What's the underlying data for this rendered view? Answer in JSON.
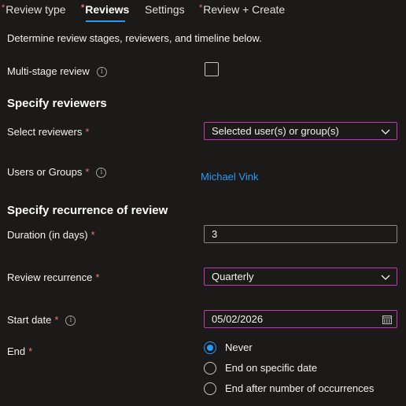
{
  "tabs": [
    {
      "label": "Review type",
      "required": true
    },
    {
      "label": "Reviews",
      "required": true,
      "active": true
    },
    {
      "label": "Settings",
      "required": false
    },
    {
      "label": "Review + Create",
      "required": true
    }
  ],
  "description": "Determine review stages, reviewers, and timeline below.",
  "multistage": {
    "label": "Multi-stage review",
    "checked": false
  },
  "reviewers_section": {
    "title": "Specify reviewers",
    "select_label": "Select reviewers",
    "select_value": "Selected user(s) or group(s)",
    "users_label": "Users or Groups",
    "users_value": "Michael Vink"
  },
  "recurrence_section": {
    "title": "Specify recurrence of review",
    "duration_label": "Duration (in days)",
    "duration_value": "3",
    "recurrence_label": "Review recurrence",
    "recurrence_value": "Quarterly",
    "start_label": "Start date",
    "start_value": "05/02/2026",
    "end_label": "End",
    "end_options": [
      {
        "label": "Never",
        "selected": true
      },
      {
        "label": "End on specific date",
        "selected": false
      },
      {
        "label": "End after number of occurrences",
        "selected": false
      }
    ]
  },
  "colors": {
    "background": "#1b1a19",
    "accent": "#2899f5",
    "required": "#f1707b",
    "focus_border": "#c239b3"
  },
  "icons": {
    "info": "info-icon",
    "dropdown": "chevron-down-icon",
    "calendar": "calendar-icon"
  }
}
